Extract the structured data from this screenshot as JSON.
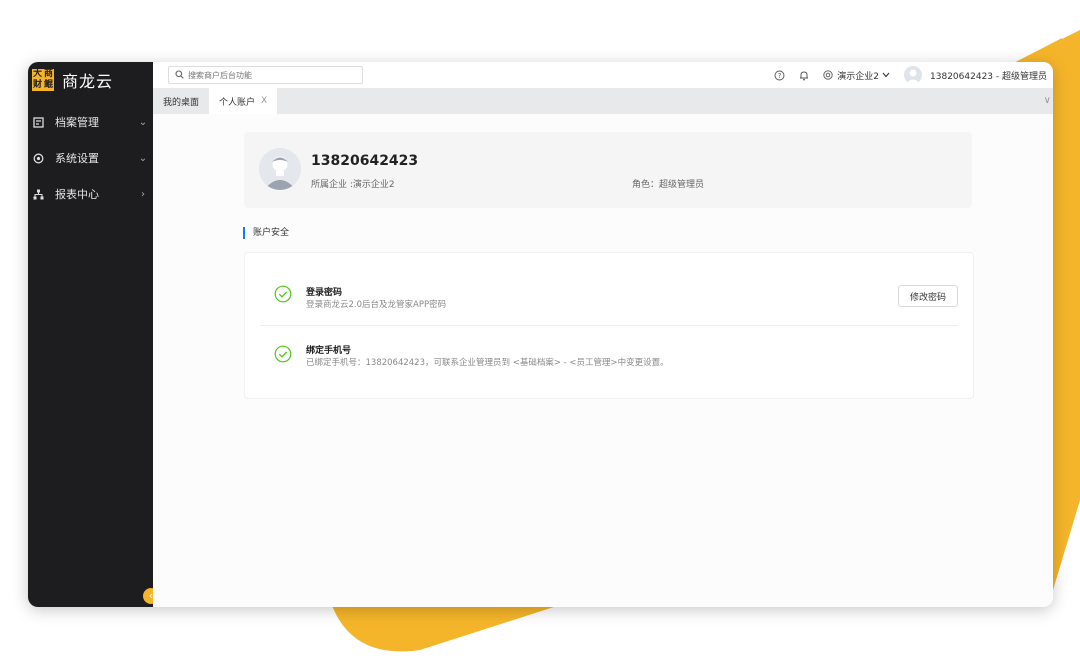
{
  "brand": {
    "logo_chars": [
      "大",
      "商",
      "财",
      "鲲"
    ],
    "name": "商龙云",
    "accent": "#f5b52a"
  },
  "sidebar": {
    "items": [
      {
        "label": "档案管理",
        "icon": "document-icon",
        "arrow": "⌄"
      },
      {
        "label": "系统设置",
        "icon": "settings-icon",
        "arrow": "⌄"
      },
      {
        "label": "报表中心",
        "icon": "org-chart-icon",
        "arrow": "›"
      }
    ],
    "collapse_glyph": "‹"
  },
  "topbar": {
    "search_placeholder": "搜索商户后台功能",
    "enterprise": "演示企业2",
    "user": "13820642423 - 超级管理员"
  },
  "tabs": [
    {
      "label": "我的桌面",
      "closable": false
    },
    {
      "label": "个人账户",
      "closable": true,
      "close_glyph": "X"
    }
  ],
  "tab_more_glyph": "∨",
  "profile": {
    "name": "13820642423",
    "enterprise_line": "所属企业 :演示企业2",
    "role_line": "角色：超级管理员"
  },
  "security": {
    "section_title": "账户安全",
    "status_color": "#52c41a",
    "items": [
      {
        "title": "登录密码",
        "desc": "登录商龙云2.0后台及龙管家APP密码",
        "button": "修改密码"
      },
      {
        "title": "绑定手机号",
        "desc": "已绑定手机号：13820642423，可联系企业管理员到 <基础档案> - <员工管理>中变更设置。"
      }
    ]
  }
}
